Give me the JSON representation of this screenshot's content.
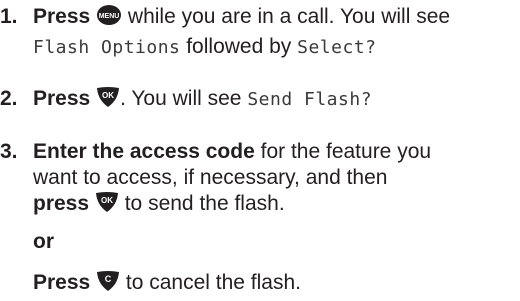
{
  "steps": [
    {
      "number": "1.",
      "line1": {
        "bold": "Press",
        "icon": "menu-key-icon",
        "icon_text": "MENU",
        "text": " while you are in a call. You will see"
      },
      "line2": {
        "display1": "Flash Options",
        "text": " followed by ",
        "display2": "Select?"
      }
    },
    {
      "number": "2.",
      "line1": {
        "bold": "Press",
        "icon": "ok-key-icon",
        "icon_text": "OK",
        "text1": ". You will see ",
        "display": "Send Flash?"
      }
    },
    {
      "number": "3.",
      "line1": {
        "bold": "Enter the access code",
        "text": " for the feature you"
      },
      "line2": {
        "text": "want to access, if necessary, and then"
      },
      "line3": {
        "bold": "press",
        "icon": "ok-key-icon",
        "icon_text": "OK",
        "text": " to send the flash."
      }
    }
  ],
  "or_label": "or",
  "cancel": {
    "bold": "Press",
    "icon": "clear-key-icon",
    "icon_text": "C",
    "text": " to cancel the flash."
  },
  "colors": {
    "text": "#231f20",
    "key_fill": "#231f20",
    "key_text": "#ffffff"
  }
}
